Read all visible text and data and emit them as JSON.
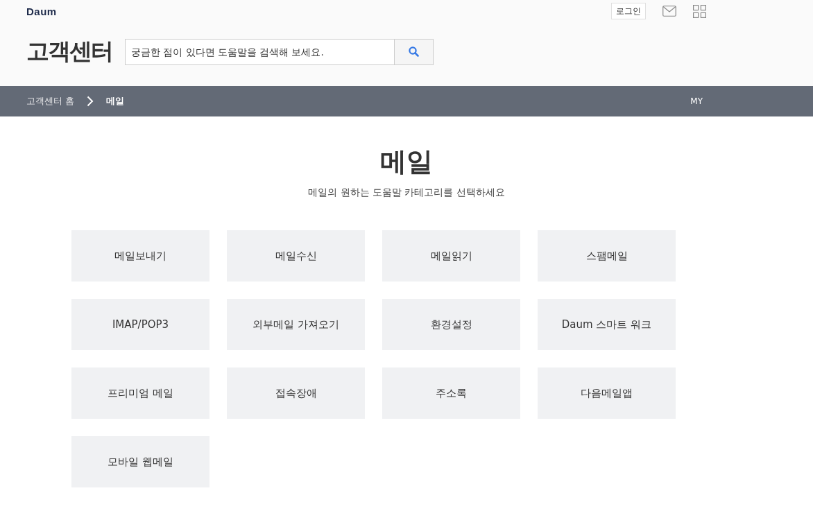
{
  "header": {
    "logo": "Daum",
    "login_button": "로그인",
    "title": "고객센터",
    "search": {
      "placeholder": "궁금한 점이 있다면 도움말을 검색해 보세요."
    }
  },
  "breadcrumb": {
    "items": [
      "고객센터 홈",
      "메일"
    ],
    "my_link": "MY"
  },
  "page": {
    "title": "메일",
    "subtitle": "메일의 원하는 도움말 카테고리를 선택하세요"
  },
  "categories": [
    "메일보내기",
    "메일수신",
    "메일읽기",
    "스팸메일",
    "IMAP/POP3",
    "외부메일 가져오기",
    "환경설정",
    "Daum 스마트 워크",
    "프리미엄 메일",
    "접속장애",
    "주소록",
    "다음메일앱",
    "모바일 웹메일"
  ]
}
